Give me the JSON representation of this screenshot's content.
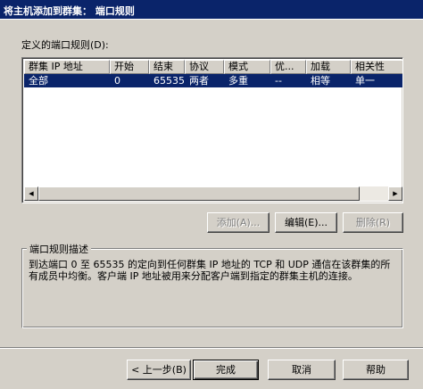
{
  "window": {
    "title": "将主机添加到群集： 端口规则"
  },
  "rules_list": {
    "label": "定义的端口规则(D):",
    "columns": [
      "群集 IP 地址",
      "开始",
      "结束",
      "协议",
      "模式",
      "优...",
      "加载",
      "相关性"
    ],
    "rows": [
      [
        "全部",
        "0",
        "65535",
        "两者",
        "多重",
        "--",
        "相等",
        "单一"
      ]
    ],
    "selected_row": 0
  },
  "actions": {
    "add_label": "添加(A)...",
    "edit_label": "编辑(E)...",
    "delete_label": "删除(R)"
  },
  "description": {
    "title": "端口规则描述",
    "text": "到达端口 0 至 65535 的定向到任何群集 IP 地址的 TCP 和 UDP 通信在该群集的所有成员中均衡。客户端 IP 地址被用来分配客户端到指定的群集主机的连接。"
  },
  "footer": {
    "back_label": "< 上一步(B)",
    "finish_label": "完成",
    "cancel_label": "取消",
    "help_label": "帮助"
  },
  "colors": {
    "titlebar": "#0a246a",
    "dialog_bg": "#d4d0c8",
    "selection": "#0a246a"
  }
}
